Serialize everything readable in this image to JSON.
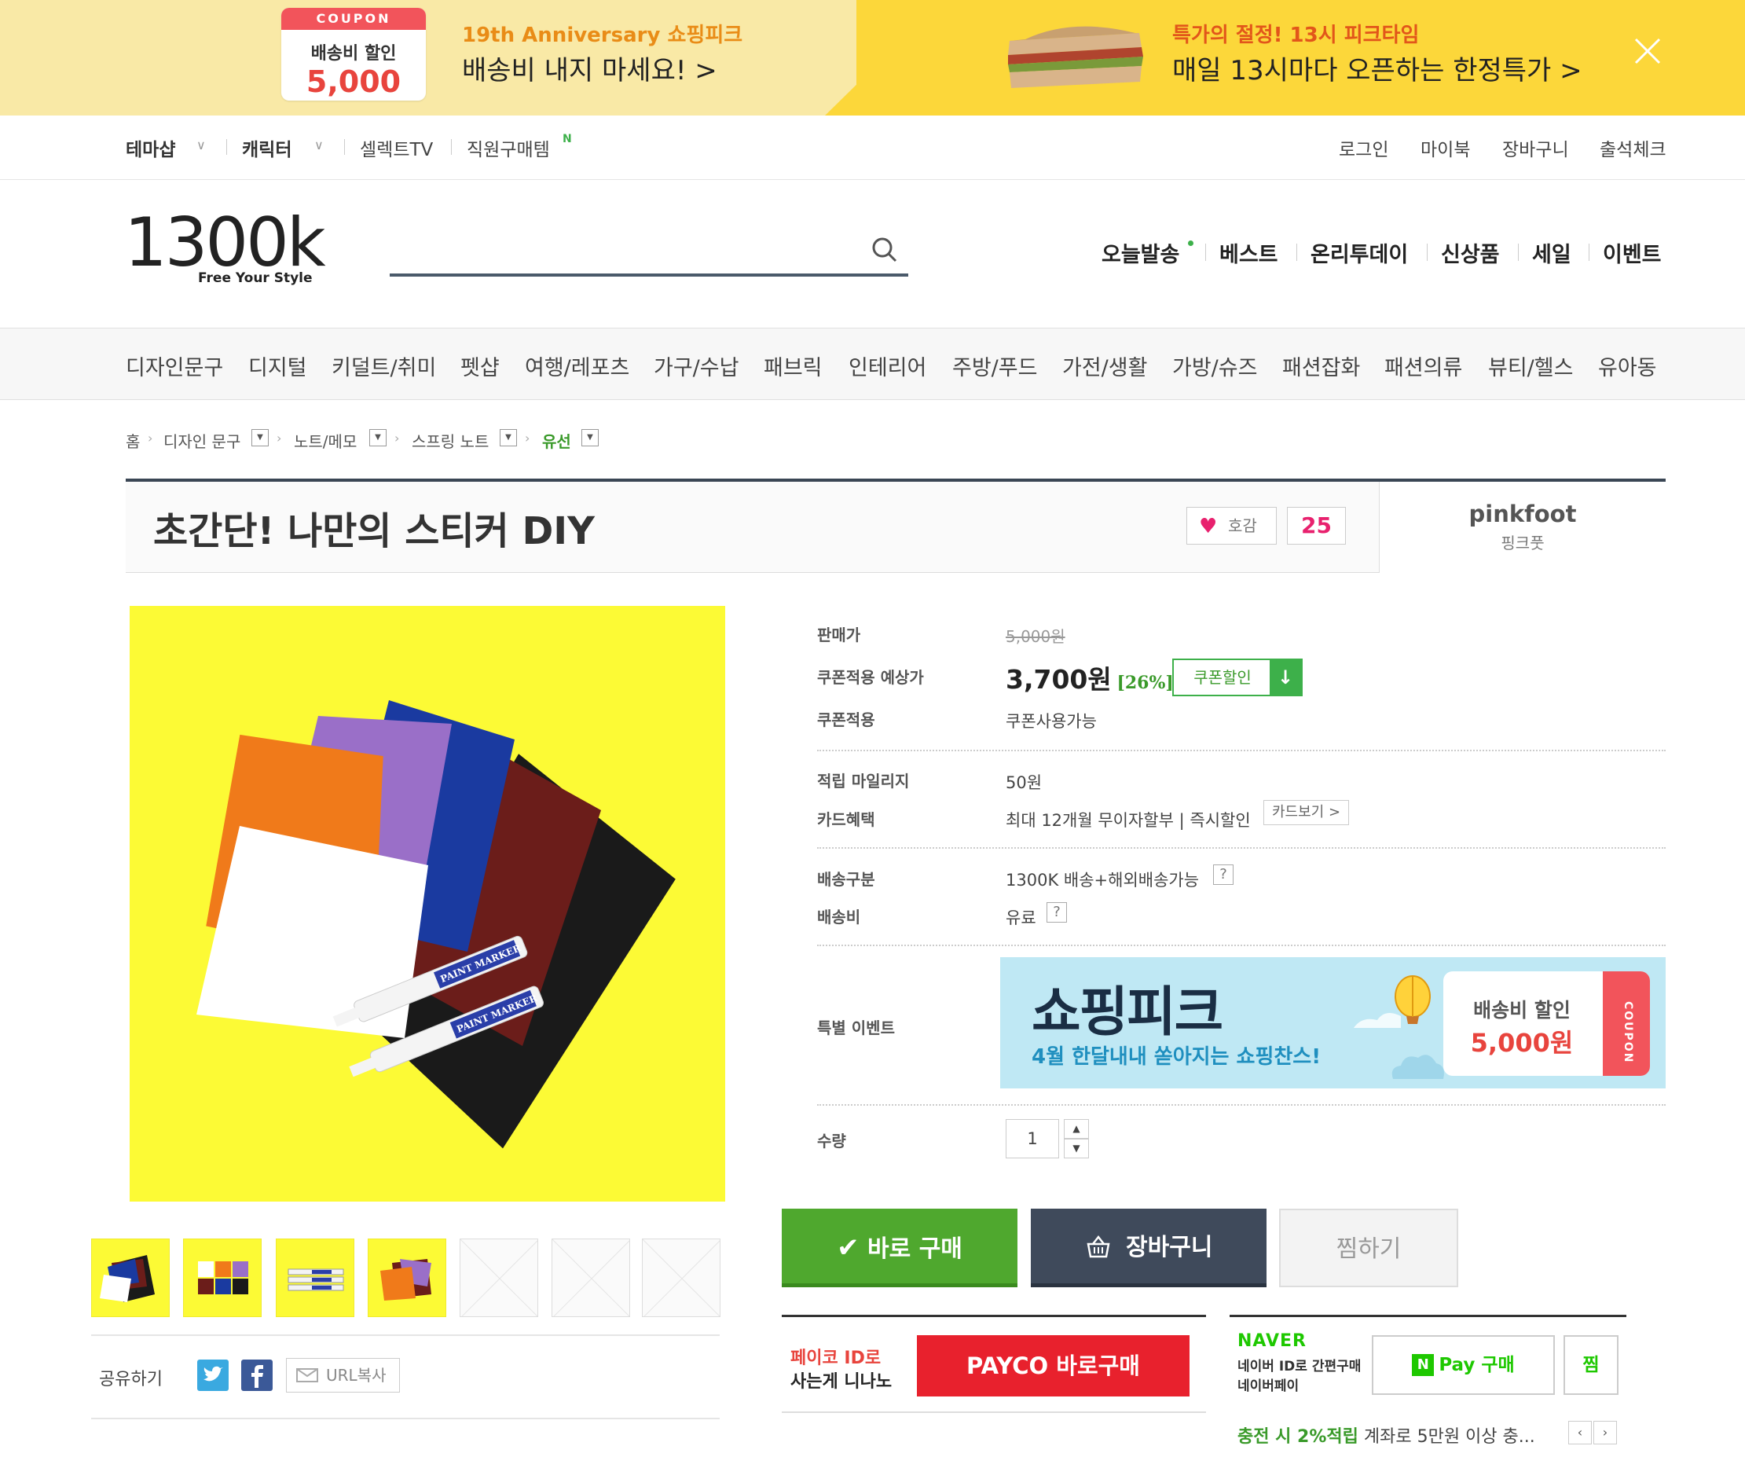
{
  "banner": {
    "coupon_head": "COUPON",
    "coupon_title": "배송비 할인",
    "coupon_amount": "5,000",
    "left_sub": "19th Anniversary 쇼핑피크",
    "left_main": "배송비 내지 마세요! >",
    "right_sub": "특가의 절정! 13시 피크타임",
    "right_main": "매일 13시마다 오픈하는 한정특가 >"
  },
  "topnav": {
    "left": [
      "테마샵",
      "캐릭터",
      "셀렉트TV",
      "직원구매템"
    ],
    "new_badge": "N",
    "right": [
      "로그인",
      "마이북",
      "장바구니",
      "출석체크"
    ]
  },
  "header": {
    "logo": "1300k",
    "logo_sub": "Free Your Style",
    "search_placeholder": "",
    "nav": [
      "오늘발송",
      "베스트",
      "온리투데이",
      "신상품",
      "세일",
      "이벤트"
    ]
  },
  "categories": [
    "디자인문구",
    "디지털",
    "키덜트/취미",
    "펫샵",
    "여행/레포츠",
    "가구/수납",
    "패브릭",
    "인테리어",
    "주방/푸드",
    "가전/생활",
    "가방/슈즈",
    "패션잡화",
    "패션의류",
    "뷰티/헬스",
    "유아동"
  ],
  "breadcrumb": [
    "홈",
    "디자인 문구",
    "노트/메모",
    "스프링 노트",
    "유선"
  ],
  "product": {
    "title": "초간단! 나만의 스티커 DIY",
    "like_label": "호감",
    "like_count": "25",
    "brand_en": "pinkfoot",
    "brand_ko": "핑크풋",
    "image_label": "PAINT MARKER"
  },
  "info": {
    "price_label": "판매가",
    "price_orig": "5,000원",
    "coupon_price_label": "쿠폰적용 예상가",
    "coupon_price": "3,700원",
    "coupon_pct": "[26%]",
    "coupon_btn": "쿠폰할인",
    "coupon_apply_label": "쿠폰적용",
    "coupon_apply_val": "쿠폰사용가능",
    "mileage_label": "적립 마일리지",
    "mileage_val": "50원",
    "card_label": "카드혜택",
    "card_val": "최대 12개월 무이자할부  |  즉시할인",
    "card_btn": "카드보기 >",
    "ship_type_label": "배송구분",
    "ship_type_val": "1300K 배송+해외배송가능",
    "ship_fee_label": "배송비",
    "ship_fee_val": "유료",
    "help": "?",
    "event_label": "특별 이벤트",
    "qty_label": "수량",
    "qty_val": "1"
  },
  "event_banner": {
    "title": "쇼핑피크",
    "sub": "4월 한달내내 쏟아지는 쇼핑찬스!",
    "coupon_title": "배송비 할인",
    "coupon_amount": "5,000원",
    "coupon_tag": "COUPON"
  },
  "actions": {
    "buy": "바로 구매",
    "cart": "장바구니",
    "wish": "찜하기"
  },
  "payco": {
    "line1": "페이코 ID로",
    "line2": "사는게 니나노",
    "button": "PAYCO 바로구매"
  },
  "naver": {
    "logo": "NAVER",
    "line1": "네이버 ID로 간편구매",
    "line2": "네이버페이",
    "npay_n": "N",
    "npay": "Pay 구매",
    "zzim": "찜",
    "promo_green": "충전 시 2%적립",
    "promo_rest": " 계좌로 5만원 이상 충..."
  },
  "share": {
    "label": "공유하기",
    "url_copy": "URL복사"
  },
  "colors": {
    "accent_green": "#4fa82e",
    "dark_navy": "#3f4a5b",
    "payco_red": "#e8212d",
    "naver_green": "#1ec800",
    "like_pink": "#e8216e",
    "product_bg": "#fcfa35"
  }
}
